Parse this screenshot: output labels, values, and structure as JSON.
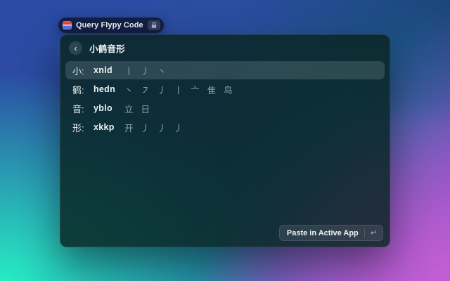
{
  "launcher_pill": {
    "title": "Query Flypy Code",
    "app_icon": "flypy-extension-icon",
    "badge_icon": "lock-icon"
  },
  "window": {
    "header": {
      "back_glyph": "‹",
      "title": "小鹤音形"
    },
    "rows": [
      {
        "label": "小:",
        "code": "xnld",
        "strokes": [
          "丨",
          "丿",
          "丶"
        ],
        "selected": true
      },
      {
        "label": "鹤:",
        "code": "hedn",
        "strokes": [
          "丶",
          "㇇",
          "丿",
          "丨",
          "亠",
          "隹",
          "鸟"
        ],
        "selected": false
      },
      {
        "label": "音:",
        "code": "yblo",
        "strokes": [
          "立",
          "日"
        ],
        "selected": false
      },
      {
        "label": "形:",
        "code": "xkkp",
        "strokes": [
          "开",
          "丿",
          "丿",
          "丿"
        ],
        "selected": false
      }
    ],
    "action_button": {
      "label": "Paste in Active App",
      "shortcut_glyph": "↵"
    }
  },
  "colors": {
    "wallpaper_top_left": "#2c49a4",
    "wallpaper_bottom_left": "#27f2c4",
    "wallpaper_bottom_right": "#c45ed4",
    "window_background": "rgba(9,37,33,0.84)",
    "selection_highlight": "rgba(230,242,238,0.15)",
    "primary_text": "#eaf0ee",
    "stroke_text": "#93a6a2",
    "app_icon_red": "#e8453c",
    "app_icon_blue": "#4a77e8"
  }
}
